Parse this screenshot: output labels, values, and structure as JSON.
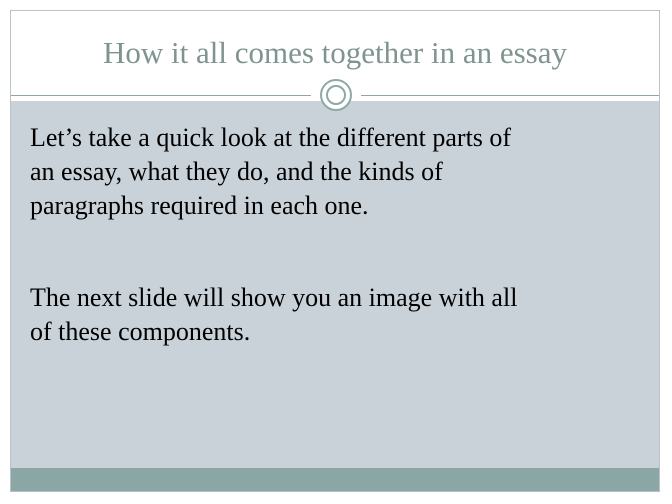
{
  "slide": {
    "title": "How it all comes together in an essay",
    "paragraphs": [
      {
        "lines": [
          "Let’s take a quick look at the different parts of",
          "an essay, what they do, and the kinds of",
          "paragraphs required in each one."
        ]
      },
      {
        "lines": [
          "The next slide will show you an image with all",
          "of these components."
        ]
      }
    ]
  },
  "colors": {
    "title_text": "#7f9490",
    "body_background": "#c9d2d9",
    "accent": "#8aa6a5",
    "body_text": "#000000"
  },
  "icons": {
    "ornament": "double-circle-ornament-icon"
  }
}
